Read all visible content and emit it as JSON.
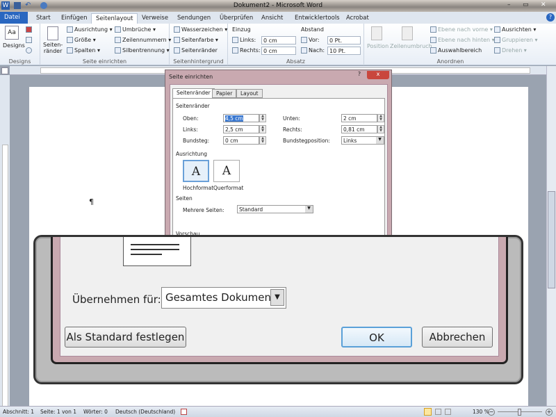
{
  "window": {
    "title": "Dokument2 - Microsoft Word"
  },
  "tabs": [
    "Datei",
    "Start",
    "Einfügen",
    "Seitenlayout",
    "Verweise",
    "Sendungen",
    "Überprüfen",
    "Ansicht",
    "Entwicklertools",
    "Acrobat"
  ],
  "ribbon": {
    "designs": {
      "label": "Designs",
      "group": "Designs"
    },
    "seite": {
      "margins": "Seiten-\nränder",
      "ausrichtung": "Ausrichtung",
      "groesse": "Größe",
      "spalten": "Spalten",
      "umbrueche": "Umbrüche",
      "zeilennummern": "Zeilennummern",
      "silbentrennung": "Silbentrennung",
      "group": "Seite einrichten"
    },
    "hintergrund": {
      "wasserzeichen": "Wasserzeichen",
      "seitenfarbe": "Seitenfarbe",
      "seitenraender": "Seitenränder",
      "group": "Seitenhintergrund"
    },
    "absatz": {
      "einzug": "Einzug",
      "links": "Links:",
      "links_val": "0 cm",
      "rechts": "Rechts:",
      "rechts_val": "0 cm",
      "abstand": "Abstand",
      "vor": "Vor:",
      "vor_val": "0 Pt.",
      "nach": "Nach:",
      "nach_val": "10 Pt.",
      "group": "Absatz"
    },
    "anordnen": {
      "position": "Position",
      "zeilenumbruch": "Zeilenumbruch",
      "vorne": "Ebene nach vorne",
      "hinten": "Ebene nach hinten",
      "auswahl": "Auswahlbereich",
      "ausrichten": "Ausrichten",
      "gruppieren": "Gruppieren",
      "drehen": "Drehen",
      "group": "Anordnen"
    }
  },
  "document": {
    "pilcrow": "¶"
  },
  "dialog": {
    "title": "Seite einrichten",
    "help": "?",
    "close": "x",
    "tabs": [
      "Seitenränder",
      "Papier",
      "Layout"
    ],
    "margins_section": "Seitenränder",
    "oben": "Oben:",
    "oben_val": "4,5 cm",
    "unten": "Unten:",
    "unten_val": "2 cm",
    "links": "Links:",
    "links_val": "2,5 cm",
    "rechts": "Rechts:",
    "rechts_val": "0,81 cm",
    "bundsteg": "Bundsteg:",
    "bundsteg_val": "0 cm",
    "bundstegpos": "Bundstegposition:",
    "bundstegpos_val": "Links",
    "orientation_section": "Ausrichtung",
    "hochformat": "Hochformat",
    "querformat": "Querformat",
    "orient_glyph": "A",
    "pages_section": "Seiten",
    "mehrere": "Mehrere Seiten:",
    "mehrere_val": "Standard",
    "preview_section": "Vorschau"
  },
  "magnified": {
    "apply_label": "Übernehmen für:",
    "apply_val": "Gesamtes Dokument",
    "default_btn": "Als Standard festlegen",
    "ok": "OK",
    "cancel": "Abbrechen"
  },
  "status": {
    "abschnitt": "Abschnitt: 1",
    "seite": "Seite: 1 von 1",
    "woerter": "Wörter: 0",
    "sprache": "Deutsch (Deutschland)",
    "zoom": "130 %"
  }
}
